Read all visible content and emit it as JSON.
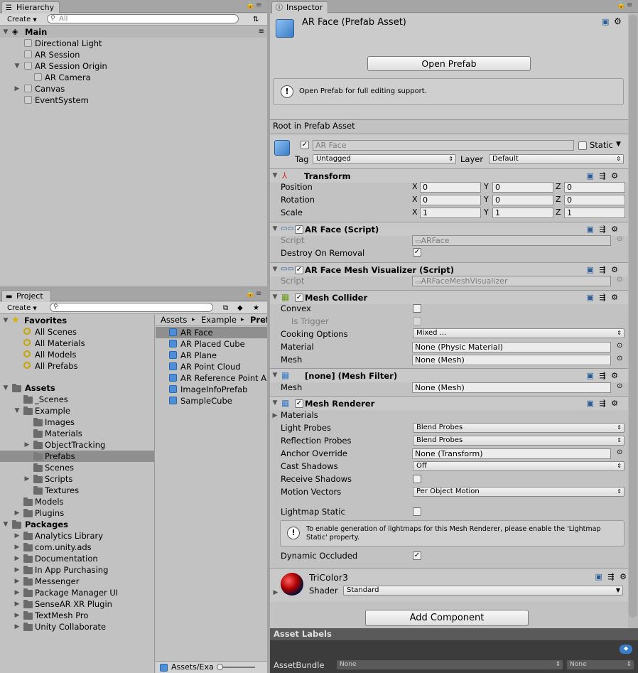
{
  "hierarchy": {
    "tab_label": "Hierarchy",
    "create_label": "Create",
    "search_placeholder": "All",
    "scene": "Main",
    "items": [
      "Directional Light",
      "AR Session",
      "AR Session Origin",
      "AR Camera",
      "Canvas",
      "EventSystem"
    ]
  },
  "project": {
    "tab_label": "Project",
    "create_label": "Create",
    "favorites_label": "Favorites",
    "favorites": [
      "All Scenes",
      "All Materials",
      "All Models",
      "All Prefabs"
    ],
    "assets_label": "Assets",
    "assets_tree": [
      "_Scenes",
      "Example",
      "Images",
      "Materials",
      "ObjectTracking",
      "Prefabs",
      "Scenes",
      "Scripts",
      "Textures",
      "Models",
      "Plugins"
    ],
    "packages_label": "Packages",
    "packages": [
      "Analytics Library",
      "com.unity.ads",
      "Documentation",
      "In App Purchasing",
      "Messenger",
      "Package Manager UI",
      "SenseAR XR Plugin",
      "TextMesh Pro",
      "Unity Collaborate"
    ],
    "breadcrumb": [
      "Assets",
      "Example",
      "Pref"
    ],
    "files": [
      "AR Face",
      "AR Placed Cube",
      "AR Plane",
      "AR Point Cloud",
      "AR Reference Point A",
      "ImageInfoPrefab",
      "SampleCube"
    ],
    "footer_path": "Assets/Exa"
  },
  "inspector": {
    "tab_label": "Inspector",
    "title": "AR Face (Prefab Asset)",
    "open_prefab_label": "Open Prefab",
    "open_prefab_help": "Open Prefab for full editing support.",
    "root_label": "Root in Prefab Asset",
    "object_name": "AR Face",
    "static_label": "Static",
    "tag_label": "Tag",
    "tag_value": "Untagged",
    "layer_label": "Layer",
    "layer_value": "Default",
    "transform": {
      "title": "Transform",
      "position_label": "Position",
      "rotation_label": "Rotation",
      "scale_label": "Scale",
      "x": "X",
      "y": "Y",
      "z": "Z",
      "position": [
        "0",
        "0",
        "0"
      ],
      "rotation": [
        "0",
        "0",
        "0"
      ],
      "scale": [
        "1",
        "1",
        "1"
      ]
    },
    "ar_face": {
      "title": "AR Face (Script)",
      "script_label": "Script",
      "script_value": "ARFace",
      "destroy_label": "Destroy On Removal"
    },
    "ar_face_mesh": {
      "title": "AR Face Mesh Visualizer (Script)",
      "script_label": "Script",
      "script_value": "ARFaceMeshVisualizer"
    },
    "mesh_collider": {
      "title": "Mesh Collider",
      "convex_label": "Convex",
      "is_trigger_label": "Is Trigger",
      "cooking_label": "Cooking Options",
      "cooking_value": "Mixed ...",
      "material_label": "Material",
      "material_value": "None (Physic Material)",
      "mesh_label": "Mesh",
      "mesh_value": "None (Mesh)"
    },
    "mesh_filter": {
      "title": "[none] (Mesh Filter)",
      "mesh_label": "Mesh",
      "mesh_value": "None (Mesh)"
    },
    "mesh_renderer": {
      "title": "Mesh Renderer",
      "materials_label": "Materials",
      "light_probes_label": "Light Probes",
      "light_probes_value": "Blend Probes",
      "reflection_label": "Reflection Probes",
      "reflection_value": "Blend Probes",
      "anchor_label": "Anchor Override",
      "anchor_value": "None (Transform)",
      "cast_label": "Cast Shadows",
      "cast_value": "Off",
      "receive_label": "Receive Shadows",
      "motion_label": "Motion Vectors",
      "motion_value": "Per Object Motion",
      "lightmap_label": "Lightmap Static",
      "lightmap_help": "To enable generation of lightmaps for this Mesh Renderer, please enable the 'Lightmap Static' property.",
      "dynamic_label": "Dynamic Occluded"
    },
    "material": {
      "name": "TriColor3",
      "shader_label": "Shader",
      "shader_value": "Standard"
    },
    "add_component_label": "Add Component",
    "asset_labels": "Asset Labels",
    "asset_bundle_label": "AssetBundle",
    "asset_bundle_value": "None",
    "asset_variant_value": "None"
  }
}
